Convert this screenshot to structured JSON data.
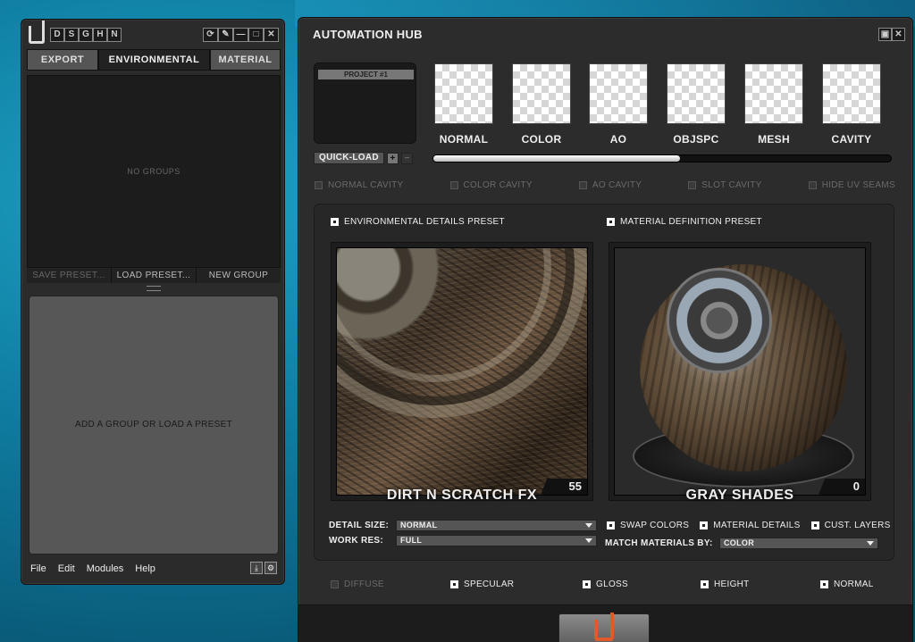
{
  "left_panel": {
    "mini_tabs": [
      "D",
      "S",
      "G",
      "H",
      "N"
    ],
    "window_buttons": [
      "⟳",
      "✎",
      "—",
      "□",
      "✕"
    ],
    "tabs": [
      {
        "label": "EXPORT",
        "active": false
      },
      {
        "label": "ENVIRONMENTAL",
        "active": true
      },
      {
        "label": "MATERIAL",
        "active": false
      }
    ],
    "groups_empty_text": "NO GROUPS",
    "preset_buttons": {
      "save": "SAVE PRESET...",
      "load": "LOAD PRESET...",
      "new_group": "NEW GROUP"
    },
    "workspace_hint": "ADD A GROUP OR LOAD A PRESET",
    "menu": [
      "File",
      "Edit",
      "Modules",
      "Help"
    ]
  },
  "hub": {
    "title": "AUTOMATION HUB",
    "project_label": "PROJECT #1",
    "quick_load_label": "QUICK-LOAD",
    "plus_label": "+",
    "minus_label": "−",
    "maps": [
      {
        "label": "NORMAL"
      },
      {
        "label": "COLOR"
      },
      {
        "label": "AO"
      },
      {
        "label": "OBJSPC"
      },
      {
        "label": "MESH"
      },
      {
        "label": "CAVITY"
      }
    ],
    "progress_fraction": 0.54,
    "cavity_options": [
      {
        "label": "NORMAL CAVITY",
        "checked": false,
        "enabled": false
      },
      {
        "label": "COLOR CAVITY",
        "checked": false,
        "enabled": false
      },
      {
        "label": "AO CAVITY",
        "checked": false,
        "enabled": false
      },
      {
        "label": "SLOT CAVITY",
        "checked": false,
        "enabled": false
      },
      {
        "label": "HIDE UV SEAMS",
        "checked": false,
        "enabled": false
      }
    ],
    "env_preset": {
      "label": "ENVIRONMENTAL DETAILS PRESET",
      "checked": true,
      "title": "DIRT N SCRATCH FX",
      "count": "55"
    },
    "mat_preset": {
      "label": "MATERIAL DEFINITION PRESET",
      "checked": true,
      "title": "GRAY SHADES",
      "count": "0"
    },
    "detail_size": {
      "label": "DETAIL SIZE:",
      "value": "NORMAL"
    },
    "work_res": {
      "label": "WORK RES:",
      "value": "FULL"
    },
    "material_options": [
      {
        "label": "SWAP COLORS",
        "checked": true
      },
      {
        "label": "MATERIAL DETAILS",
        "checked": true
      },
      {
        "label": "CUST. LAYERS",
        "checked": true
      }
    ],
    "match_materials": {
      "label": "MATCH MATERIALS BY:",
      "value": "COLOR"
    },
    "output_channels": [
      {
        "label": "DIFFUSE",
        "checked": false,
        "enabled": false
      },
      {
        "label": "SPECULAR",
        "checked": true,
        "enabled": true
      },
      {
        "label": "GLOSS",
        "checked": true,
        "enabled": true
      },
      {
        "label": "HEIGHT",
        "checked": true,
        "enabled": true
      },
      {
        "label": "NORMAL",
        "checked": true,
        "enabled": true
      }
    ]
  },
  "colors": {
    "accent": "#e05a2a",
    "panel": "#2c2c2c",
    "background": "#0f7fa3"
  }
}
